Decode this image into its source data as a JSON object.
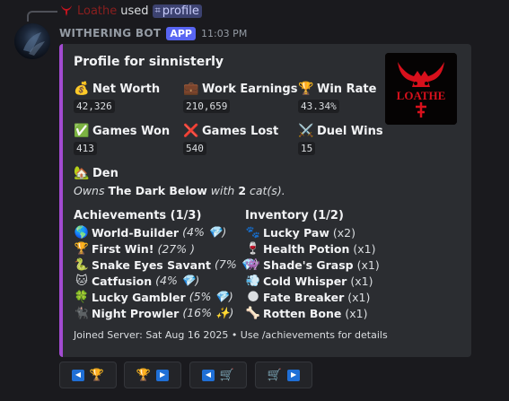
{
  "reply": {
    "user": "Loathe",
    "action": "used",
    "command": "profile",
    "command_icon": "slash-command-icon"
  },
  "message": {
    "bot_name": "WITHERING BOT",
    "badge": "APP",
    "timestamp": "11:03 PM"
  },
  "embed": {
    "accent_color": "#a24bd1",
    "title": "Profile for sinnisterly",
    "thumbnail_text": "LOATHE",
    "stats": [
      {
        "icon": "money-bag-icon",
        "emoji": "💰",
        "label": "Net Worth",
        "value": "42,326"
      },
      {
        "icon": "briefcase-icon",
        "emoji": "💼",
        "label": "Work Earnings",
        "value": "210,659"
      },
      {
        "icon": "trophy-icon",
        "emoji": "🏆",
        "label": "Win Rate",
        "value": "43.34%"
      },
      {
        "icon": "check-mark-icon",
        "emoji": "✅",
        "label": "Games Won",
        "value": "413"
      },
      {
        "icon": "cross-mark-icon",
        "emoji": "❌",
        "label": "Games Lost",
        "value": "540"
      },
      {
        "icon": "crossed-swords-icon",
        "emoji": "⚔️",
        "label": "Duel Wins",
        "value": "15"
      }
    ],
    "den": {
      "emoji": "🏡",
      "label": "Den",
      "owns_prefix": "Owns",
      "den_name": "The Dark Below",
      "with_text": "with",
      "cat_count": "2",
      "cat_suffix": "cat(s)."
    },
    "achievements": {
      "heading": "Achievements (1/3)",
      "items": [
        {
          "emoji": "🌎",
          "name": "World-Builder",
          "extra": "(4% 💎)"
        },
        {
          "emoji": "🏆",
          "name": "First Win!",
          "extra": "(27% )"
        },
        {
          "emoji": "🐍",
          "name": "Snake Eyes Savant",
          "extra": "(7% 💎)"
        },
        {
          "emoji": "🐱",
          "name": "Catfusion",
          "extra": "(4% 💎)"
        },
        {
          "emoji": "🍀",
          "name": "Lucky Gambler",
          "extra": "(5% 💎)"
        },
        {
          "emoji": "🐈‍⬛",
          "name": "Night Prowler",
          "extra": "(16% ✨)"
        }
      ]
    },
    "inventory": {
      "heading": "Inventory (1/2)",
      "items": [
        {
          "emoji": "🐾",
          "name": "Lucky Paw",
          "extra": "(x2)"
        },
        {
          "emoji": "🍷",
          "name": "Health Potion",
          "extra": "(x1)"
        },
        {
          "emoji": "👾",
          "name": "Shade's Grasp",
          "extra": "(x1)"
        },
        {
          "emoji": "💨",
          "name": "Cold Whisper",
          "extra": "(x1)"
        },
        {
          "emoji": "🌑",
          "name": "Fate Breaker",
          "extra": "(x1)"
        },
        {
          "emoji": "🦴",
          "name": "Rotten Bone",
          "extra": "(x1)"
        }
      ]
    },
    "footer": "Joined Server: Sat Aug 16 2025 • Use /achievements for details"
  },
  "buttons": [
    {
      "name": "prev-achievements-button",
      "left_icon": "◀",
      "emoji": "🏆",
      "right_icon": ""
    },
    {
      "name": "next-achievements-button",
      "left_icon": "",
      "emoji": "🏆",
      "right_icon": "▶"
    },
    {
      "name": "prev-inventory-button",
      "left_icon": "◀",
      "emoji": "🛒",
      "right_icon": ""
    },
    {
      "name": "next-inventory-button",
      "left_icon": "",
      "emoji": "🛒",
      "right_icon": "▶"
    }
  ]
}
